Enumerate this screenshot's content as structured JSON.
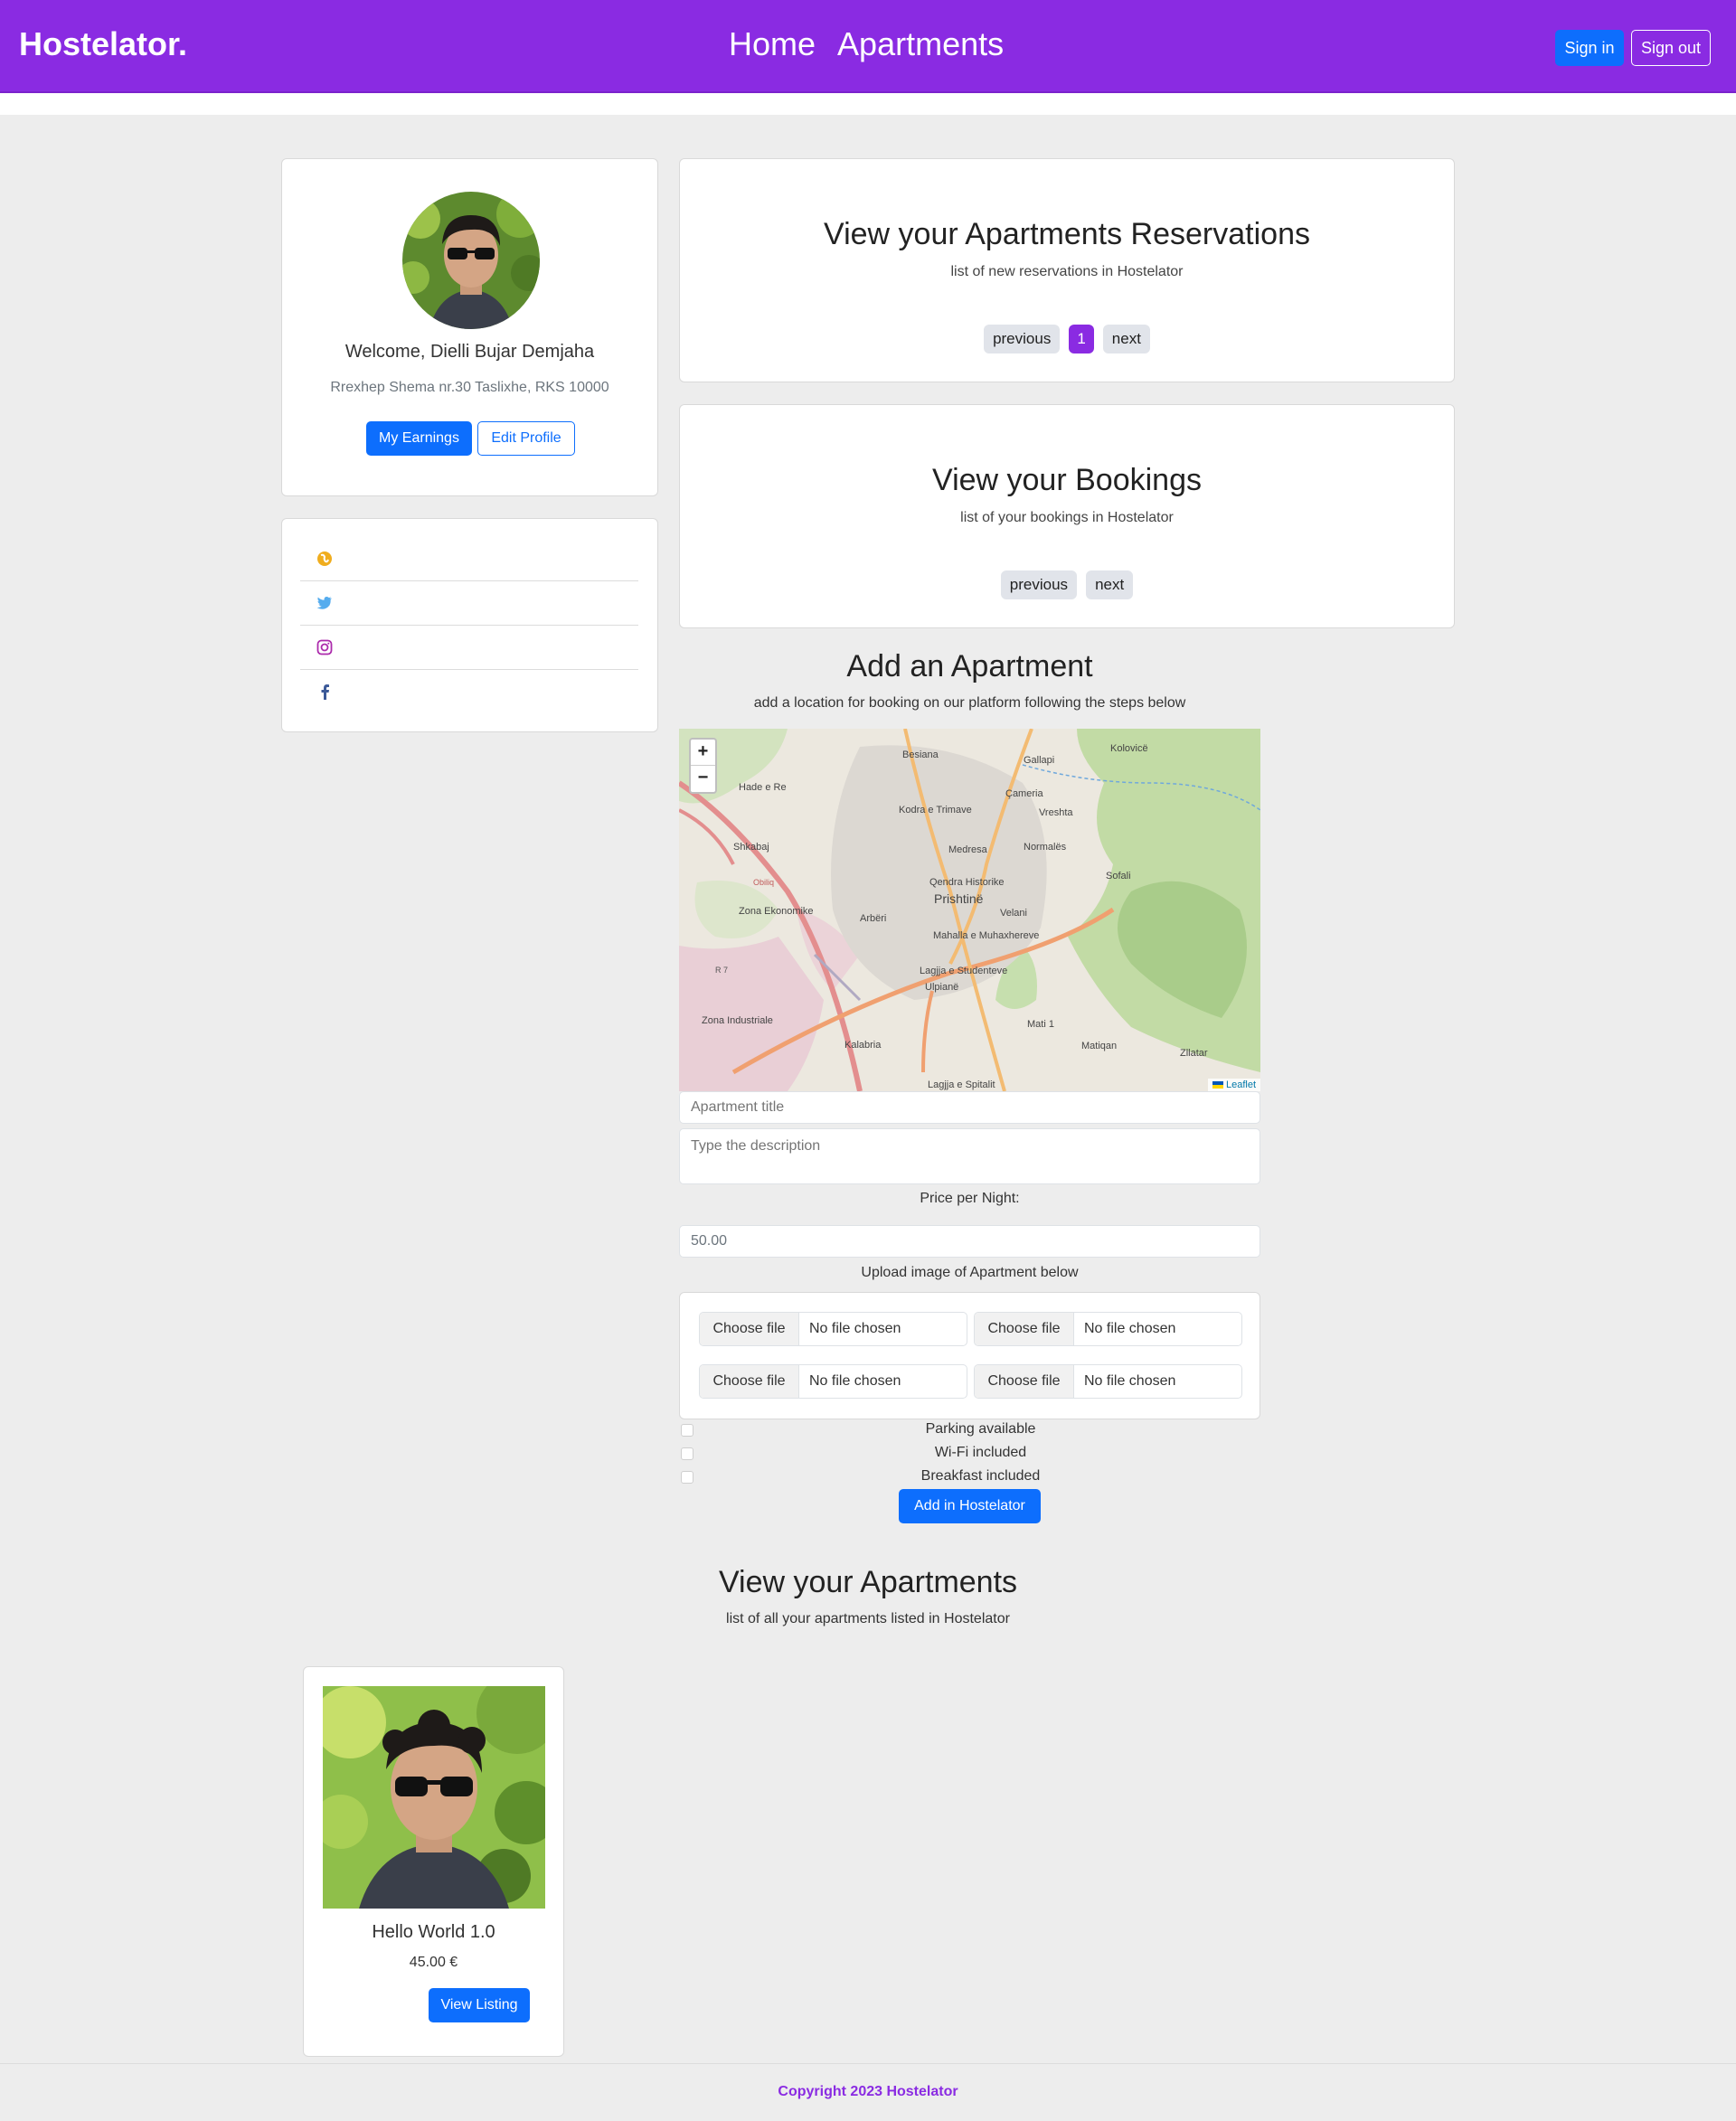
{
  "navbar": {
    "brand": "Hostelator.",
    "links": [
      "Home",
      "Apartments"
    ],
    "sign_in": "Sign in",
    "sign_out": "Sign out"
  },
  "profile": {
    "welcome": "Welcome, Dielli Bujar Demjaha",
    "address": "Rrexhep Shema nr.30 Taslixhe, RKS 10000",
    "earnings_button": "My Earnings",
    "edit_button": "Edit Profile"
  },
  "social": {
    "icons": [
      "globe-icon",
      "twitter-icon",
      "instagram-icon",
      "facebook-icon"
    ],
    "colors": {
      "globe": "#f0ad1e",
      "twitter": "#55acee",
      "instagram": "#ac2bac",
      "facebook": "#3b5998"
    }
  },
  "reservations": {
    "title": "View your Apartments Reservations",
    "subtitle": "list of new reservations in Hostelator",
    "previous": "previous",
    "page": "1",
    "next": "next"
  },
  "bookings": {
    "title": "View your Bookings",
    "subtitle": "list of your bookings in Hostelator",
    "previous": "previous",
    "next": "next"
  },
  "add_apartment": {
    "title": "Add an Apartment",
    "subtitle": "add a location for booking on our platform following the steps below",
    "map": {
      "zoom_in": "+",
      "zoom_out": "−",
      "attribution": "Leaflet",
      "places": [
        "Besiana",
        "Gallapi",
        "Kolovicë",
        "Hade e Re",
        "Çameria",
        "Kodra e Trimave",
        "Vreshta",
        "Shkabaj",
        "Medresa",
        "Normalës",
        "Sofali",
        "Qendra Historike",
        "Prishtinë",
        "Zona Ekonomike",
        "Arbëri",
        "Velani",
        "Mahalla e Muhaxhereve",
        "Lagjja e Studenteve",
        "Ulpianë",
        "Zona Industriale",
        "Mati 1",
        "Kalabria",
        "Matiqan",
        "Zllatar",
        "Lagjja e Spitalit",
        "Obiliq",
        "R 7"
      ]
    },
    "title_placeholder": "Apartment title",
    "description_placeholder": "Type the description",
    "price_label": "Price per Night:",
    "price_value": "50.00",
    "upload_label": "Upload image of Apartment below",
    "file_inputs": [
      {
        "button": "Choose file",
        "status": "No file chosen"
      },
      {
        "button": "Choose file",
        "status": "No file chosen"
      },
      {
        "button": "Choose file",
        "status": "No file chosen"
      },
      {
        "button": "Choose file",
        "status": "No file chosen"
      }
    ],
    "amenities": [
      "Parking available",
      "Wi-Fi included",
      "Breakfast included"
    ],
    "submit": "Add in Hostelator"
  },
  "apartments": {
    "title": "View your Apartments",
    "subtitle": "list of all your apartments listed in Hostelator",
    "items": [
      {
        "name": "Hello World 1.0",
        "price": "45.00 €",
        "button": "View Listing"
      }
    ]
  },
  "footer": {
    "text": "Copyright 2023 Hostelator"
  },
  "theme": {
    "accent": "#8a2be2",
    "primary": "#0d6efd"
  }
}
